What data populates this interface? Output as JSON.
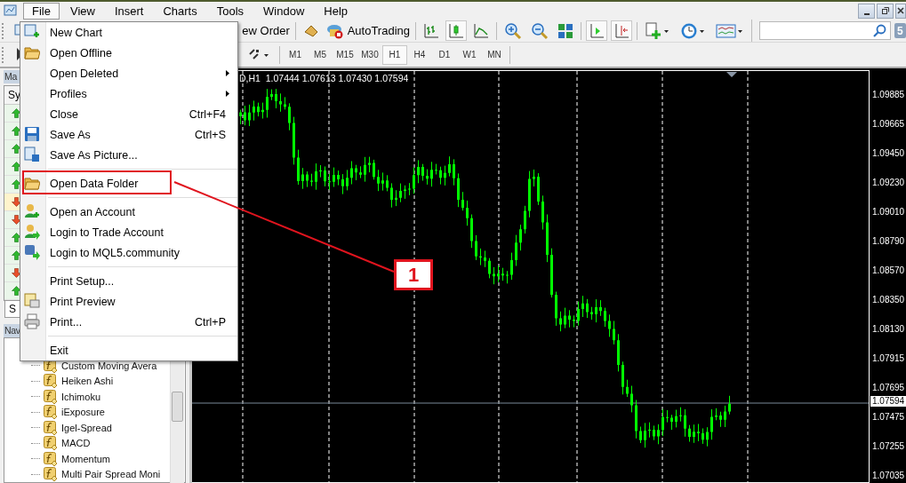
{
  "menubar": [
    {
      "label": "File",
      "selected": true
    },
    {
      "label": "View",
      "selected": false
    },
    {
      "label": "Insert",
      "selected": false
    },
    {
      "label": "Charts",
      "selected": false
    },
    {
      "label": "Tools",
      "selected": false
    },
    {
      "label": "Window",
      "selected": false
    },
    {
      "label": "Help",
      "selected": false
    }
  ],
  "file_menu": [
    {
      "kind": "item",
      "label": "New Chart",
      "annotated": false
    },
    {
      "kind": "item",
      "label": "Open Offline",
      "annotated": false
    },
    {
      "kind": "submenu",
      "label": "Open Deleted",
      "annotated": false
    },
    {
      "kind": "submenu",
      "label": "Profiles",
      "annotated": false
    },
    {
      "kind": "item",
      "label": "Close",
      "shortcut": "Ctrl+F4",
      "annotated": false
    },
    {
      "kind": "item",
      "label": "Save As",
      "shortcut": "Ctrl+S",
      "annotated": false
    },
    {
      "kind": "item",
      "label": "Save As Picture...",
      "annotated": false
    },
    {
      "kind": "separator"
    },
    {
      "kind": "item",
      "label": "Open Data Folder",
      "annotated": true
    },
    {
      "kind": "separator"
    },
    {
      "kind": "item",
      "label": "Open an Account",
      "annotated": false
    },
    {
      "kind": "item",
      "label": "Login to Trade Account",
      "annotated": false
    },
    {
      "kind": "item",
      "label": "Login to MQL5.community",
      "annotated": false
    },
    {
      "kind": "separator"
    },
    {
      "kind": "item",
      "label": "Print Setup...",
      "annotated": false
    },
    {
      "kind": "item",
      "label": "Print Preview",
      "annotated": false
    },
    {
      "kind": "item",
      "label": "Print...",
      "shortcut": "Ctrl+P",
      "annotated": false
    },
    {
      "kind": "separator"
    },
    {
      "kind": "item",
      "label": "Exit",
      "annotated": false
    }
  ],
  "toolbar": {
    "new_order": "ew Order",
    "autotrading": "AutoTrading",
    "chart_types": [
      {
        "selected": false
      },
      {
        "selected": true
      },
      {
        "selected": false
      }
    ],
    "toggles": [
      {
        "on": true
      },
      {
        "on": true
      }
    ],
    "notification_count": "5"
  },
  "timeframes": [
    {
      "label": "M1",
      "selected": false
    },
    {
      "label": "M5",
      "selected": false
    },
    {
      "label": "M15",
      "selected": false
    },
    {
      "label": "M30",
      "selected": false
    },
    {
      "label": "H1",
      "selected": true
    },
    {
      "label": "H4",
      "selected": false
    },
    {
      "label": "D1",
      "selected": false
    },
    {
      "label": "W1",
      "selected": false
    },
    {
      "label": "MN",
      "selected": false
    }
  ],
  "market_watch": {
    "title": "Ma",
    "column": "Sy",
    "tab": "S",
    "rows": [
      {
        "kind": "up",
        "highlighted": false
      },
      {
        "kind": "up",
        "highlighted": false
      },
      {
        "kind": "up",
        "highlighted": false
      },
      {
        "kind": "up",
        "highlighted": false
      },
      {
        "kind": "up",
        "highlighted": false
      },
      {
        "kind": "down",
        "highlighted": true
      },
      {
        "kind": "down",
        "highlighted": false
      },
      {
        "kind": "up",
        "highlighted": false
      },
      {
        "kind": "up",
        "highlighted": false
      },
      {
        "kind": "down",
        "highlighted": false
      },
      {
        "kind": "up",
        "highlighted": false
      }
    ]
  },
  "navigator": {
    "title": "Nav",
    "items": [
      "Custom Moving Avera",
      "Heiken Ashi",
      "Ichimoku",
      "iExposure",
      "Igel-Spread",
      "MACD",
      "Momentum",
      "Multi Pair Spread Moni"
    ]
  },
  "chart": {
    "header": "D,H1  1.07444 1.07613 1.07430 1.07594",
    "price_labels": [
      "1.09885",
      "1.09665",
      "1.09450",
      "1.09230",
      "1.09010",
      "1.08790",
      "1.08570",
      "1.08350",
      "1.08130",
      "1.07915",
      "1.07695",
      "1.07475",
      "1.07255",
      "1.07035"
    ],
    "current_price": "1.07594"
  },
  "annotation": {
    "label": "1"
  }
}
